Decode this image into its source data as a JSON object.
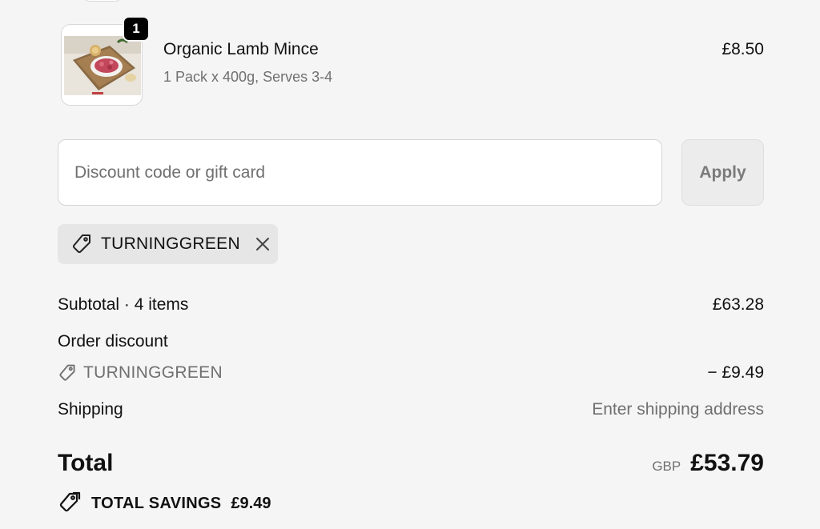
{
  "line_item": {
    "quantity": "1",
    "name": "Organic Lamb Mince",
    "variant": "1 Pack x 400g, Serves 3-4",
    "price": "£8.50",
    "image_icon": "product-image"
  },
  "discount": {
    "placeholder": "Discount code or gift card",
    "value": "",
    "apply_label": "Apply",
    "applied_code": "TURNINGGREEN"
  },
  "summary": {
    "subtotal_label": "Subtotal · 4 items",
    "subtotal_value": "£63.28",
    "order_discount_label": "Order discount",
    "discount_code": "TURNINGGREEN",
    "discount_value": "− £9.49",
    "shipping_label": "Shipping",
    "shipping_value": "Enter shipping address",
    "total_label": "Total",
    "total_currency": "GBP",
    "total_value": "£53.79",
    "savings_label": "TOTAL SAVINGS",
    "savings_value": "£9.49"
  },
  "colors": {
    "background": "#f5f5f5",
    "text": "#111111",
    "muted": "#707070",
    "badge": "#000000",
    "chip": "#e6e6e6"
  }
}
